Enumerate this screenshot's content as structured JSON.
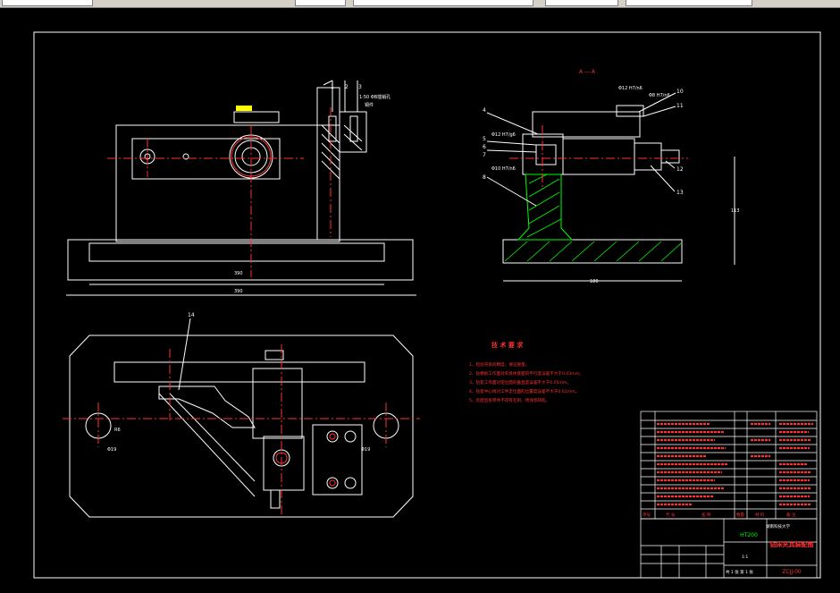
{
  "section_title": "A — A",
  "tech_req": {
    "title": "技 术 要 求",
    "items": [
      "1、检验夹具的精度，保证质量。",
      "2、钻模板工作面对夹具体底面的平行度误差不大于0.03mm。",
      "3、钻套工作面对定位面的垂直度误差不大于0.05mm。",
      "4、钻套中心线对工件定位面的位置度误差不大于0.02mm。",
      "5、装配后各零件不得有毛刺、锈蚀等缺陷。"
    ]
  },
  "callouts": [
    "1",
    "2",
    "3",
    "4",
    "5",
    "6",
    "7",
    "8",
    "10",
    "11",
    "12",
    "13",
    "14"
  ],
  "dims": {
    "front_inner": "390",
    "front_outer": "390",
    "side_height": "113",
    "side_width": "180",
    "r1": "R6",
    "d1": "Φ19",
    "d2": "Φ19",
    "fit1": "Φ12 H7/n6",
    "fit2": "Φ8 H7/n6",
    "fit3": "Φ12 H7/g6",
    "fit4": "Φ10 H7/n6",
    "plate_note": "1:50 ΦB插销孔",
    "plate_note2": "铜件"
  },
  "title_block": {
    "material": "HT200",
    "drawing_name": "钻床夹具装配图",
    "drawing_no": "ZCJJ-00",
    "scale": "1:1",
    "sheet": "共 1 张 第 1 张",
    "header_labels": [
      "序号",
      "代 号",
      "名 称",
      "数量",
      "材 料",
      "备 注"
    ],
    "school": "湖南科技大学"
  },
  "colors": {
    "white": "#ffffff",
    "red": "#ff3030",
    "yellow": "#ffff00",
    "green": "#00ff00",
    "cyan": "#00ffff",
    "magenta": "#ff00ff"
  }
}
